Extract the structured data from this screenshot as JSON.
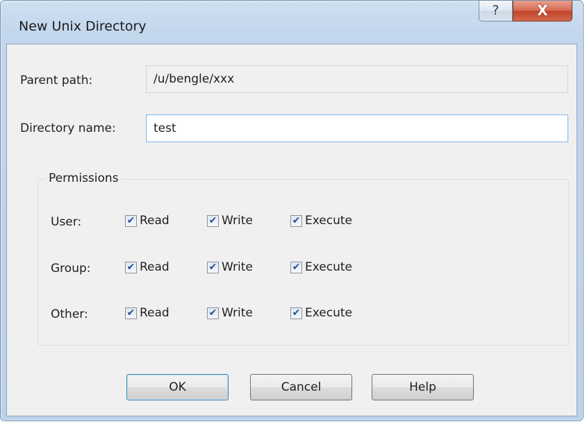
{
  "window": {
    "title": "New Unix Directory",
    "help_button_label": "?",
    "close_button_label": "X"
  },
  "form": {
    "parent_path_label": "Parent path:",
    "parent_path_value": "/u/bengle/xxx",
    "directory_name_label": "Directory name:",
    "directory_name_value": "test"
  },
  "permissions": {
    "title": "Permissions",
    "columns": [
      "Read",
      "Write",
      "Execute"
    ],
    "rows": [
      {
        "label": "User:",
        "read": true,
        "write": true,
        "execute": true
      },
      {
        "label": "Group:",
        "read": true,
        "write": true,
        "execute": true
      },
      {
        "label": "Other:",
        "read": true,
        "write": true,
        "execute": true
      }
    ]
  },
  "buttons": {
    "ok": "OK",
    "cancel": "Cancel",
    "help": "Help"
  },
  "icons": {
    "checkmark": "✔",
    "help": "question-icon",
    "close": "close-icon"
  },
  "colors": {
    "title_bar": "#bcd2ea",
    "close_button": "#c2432a",
    "focus_border": "#7eb4ea",
    "default_button_border": "#3c7fb1"
  }
}
